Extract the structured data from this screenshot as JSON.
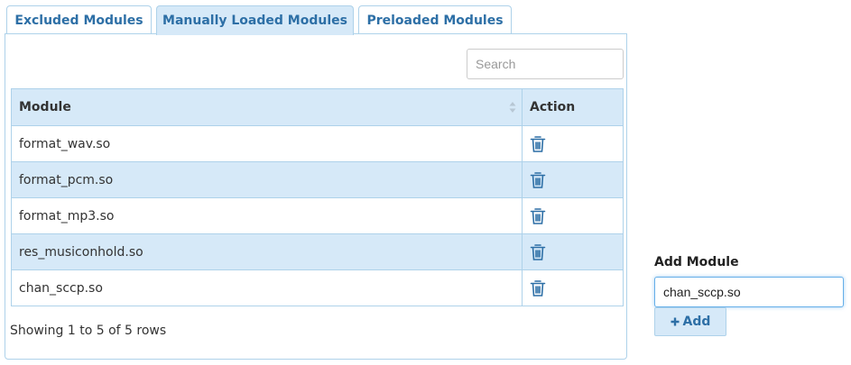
{
  "tabs": [
    {
      "label": "Excluded Modules",
      "active": false
    },
    {
      "label": "Manually Loaded Modules",
      "active": true
    },
    {
      "label": "Preloaded Modules",
      "active": false
    }
  ],
  "search": {
    "placeholder": "Search",
    "value": ""
  },
  "table": {
    "columns": [
      "Module",
      "Action"
    ],
    "rows": [
      {
        "module": "format_wav.so",
        "action_icon": "trash-icon"
      },
      {
        "module": "format_pcm.so",
        "action_icon": "trash-icon"
      },
      {
        "module": "format_mp3.so",
        "action_icon": "trash-icon"
      },
      {
        "module": "res_musiconhold.so",
        "action_icon": "trash-icon"
      },
      {
        "module": "chan_sccp.so",
        "action_icon": "trash-icon"
      }
    ]
  },
  "pagination": {
    "summary": "Showing 1 to 5 of 5 rows"
  },
  "add_module": {
    "label": "Add Module",
    "input_value": "chan_sccp.so",
    "button_label": "Add",
    "button_icon": "plus-icon"
  },
  "colors": {
    "accent": "#2d6fa6",
    "header_bg": "#d6e9f8",
    "border": "#aed2ea"
  }
}
